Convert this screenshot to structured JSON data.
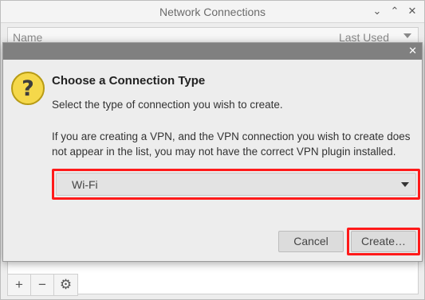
{
  "background_window": {
    "title": "Network Connections",
    "controls": {
      "minimize": "⌄",
      "maximize": "⌃",
      "close": "✕"
    },
    "list_header": {
      "name": "Name",
      "last_used": "Last Used"
    },
    "toolbar": {
      "add": "+",
      "remove": "−",
      "settings": "⚙"
    }
  },
  "dialog": {
    "close": "✕",
    "icon": "question-icon",
    "icon_glyph": "?",
    "heading": "Choose a Connection Type",
    "subtitle": "Select the type of connection you wish to create.",
    "description": "If you are creating a VPN, and the VPN connection you wish to create does not appear in the list, you may not have the correct VPN plugin installed.",
    "connection_type": {
      "selected": "Wi-Fi"
    },
    "buttons": {
      "cancel": "Cancel",
      "create": "Create…"
    }
  },
  "colors": {
    "highlight": "#ff1a1a",
    "question_icon": "#f5d84a",
    "dialog_titlebar": "#808080"
  }
}
